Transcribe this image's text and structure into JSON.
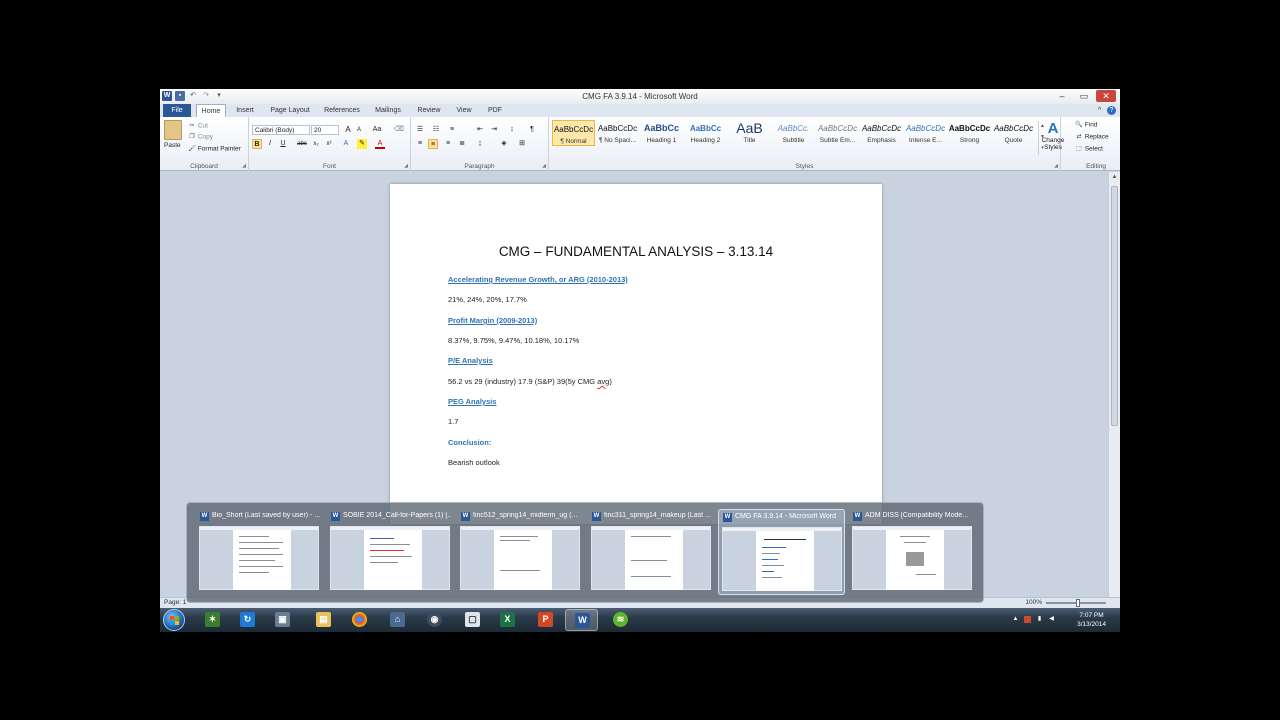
{
  "window": {
    "title": "CMG FA 3.9.14  -  Microsoft Word"
  },
  "ribbon": {
    "tabs": [
      "File",
      "Home",
      "Insert",
      "Page Layout",
      "References",
      "Mailings",
      "Review",
      "View",
      "PDF"
    ],
    "active_tab": "Home",
    "clipboard": {
      "label": "Clipboard",
      "paste": "Paste",
      "cut": "Cut",
      "copy": "Copy",
      "format_painter": "Format Painter"
    },
    "font": {
      "label": "Font",
      "font_name": "Calibri (Body)",
      "font_size": "20",
      "grow_glyph": "A",
      "shrink_glyph": "A",
      "case_glyph": "Aa",
      "bold": "B",
      "italic": "I",
      "underline": "U",
      "strike": "abc",
      "subscript": "x₂",
      "superscript": "x²"
    },
    "paragraph": {
      "label": "Paragraph"
    },
    "styles": {
      "label": "Styles",
      "items": [
        {
          "sample": "AaBbCcDc",
          "name": "¶ Normal"
        },
        {
          "sample": "AaBbCcDc",
          "name": "¶ No Spaci..."
        },
        {
          "sample": "AaBbCc",
          "name": "Heading 1"
        },
        {
          "sample": "AaBbCc",
          "name": "Heading 2"
        },
        {
          "sample": "AaB",
          "name": "Title"
        },
        {
          "sample": "AaBbCc.",
          "name": "Subtitle"
        },
        {
          "sample": "AaBbCcDc",
          "name": "Subtle Em..."
        },
        {
          "sample": "AaBbCcDc",
          "name": "Emphasis"
        },
        {
          "sample": "AaBbCcDc",
          "name": "Intense E..."
        },
        {
          "sample": "AaBbCcDc",
          "name": "Strong"
        },
        {
          "sample": "AaBbCcDc",
          "name": "Quote"
        }
      ],
      "change_styles": "Change Styles",
      "change_styles_line1": "Change",
      "change_styles_line2": "Styles"
    },
    "editing": {
      "label": "Editing",
      "find": "Find",
      "replace": "Replace",
      "select": "Select"
    }
  },
  "document": {
    "title": "CMG – FUNDAMENTAL ANALYSIS – 3.13.14",
    "sections": [
      {
        "heading": "Accelerating Revenue Growth, or ARG (2010-2013)",
        "body": "21%, 24%, 20%, 17.7%"
      },
      {
        "heading": "Profit Margin (2009-2013)",
        "body": "8.37%, 9.75%, 9.47%, 10.18%, 10.17%"
      },
      {
        "heading": "P/E Analysis",
        "body_main": "56.2 vs 29 (industry) 17.9 (S&P) 39(5y CMG ",
        "body_squiggle": "avg",
        "body_end": ")"
      },
      {
        "heading": "PEG Analysis",
        "body": "1.7"
      },
      {
        "heading": "Conclusion:",
        "body": "Bearish outlook"
      }
    ]
  },
  "statusbar": {
    "page": "Page: 1",
    "zoom": "100%"
  },
  "taskbar": {
    "time": "7:07 PM",
    "date": "3/13/2014"
  },
  "previews": [
    {
      "title": "Bio_Short (Last saved by user) - ..."
    },
    {
      "title": "SOBIE 2014_Call-for-Papers (1) [..."
    },
    {
      "title": "finc512_spring14_midterm_ug (..."
    },
    {
      "title": "finc311_spring14_makeup (Last ..."
    },
    {
      "title": "CMG FA 3.9.14 - Microsoft Word"
    },
    {
      "title": "ADM DISS [Compatibility Mode..."
    }
  ],
  "colors": {
    "accent": "#2b5797",
    "heading_link": "#2e74b5",
    "selected_style": "#fde8a9"
  }
}
